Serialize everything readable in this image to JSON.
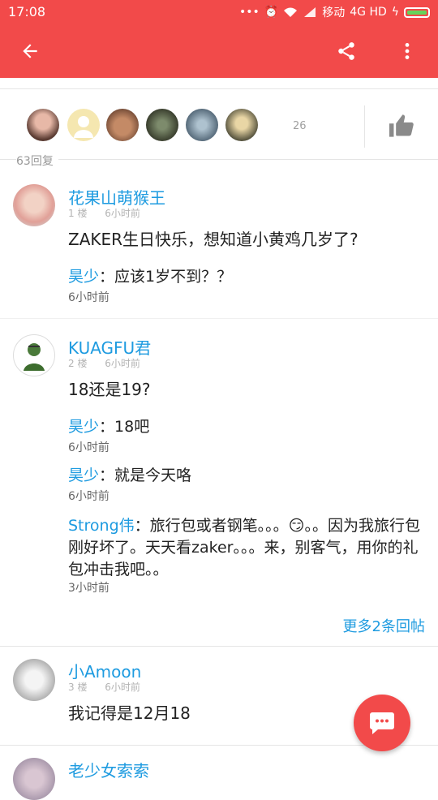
{
  "status": {
    "time": "17:08",
    "carrier": "移动",
    "network": "4G HD"
  },
  "likes": {
    "count": "26"
  },
  "replies_label": "63回复",
  "comments": [
    {
      "user": "花果山萌猴王",
      "floor": "1 楼",
      "time": "6小时前",
      "text": "ZAKER生日快乐，想知道小黄鸡几岁了?",
      "replies": [
        {
          "name": "昊少",
          "sep": "：",
          "text": "应该1岁不到？？",
          "time": "6小时前"
        }
      ]
    },
    {
      "user": "KUAGFU君",
      "floor": "2 楼",
      "time": "6小时前",
      "text": "18还是19?",
      "replies": [
        {
          "name": "昊少",
          "sep": "：",
          "text": "18吧",
          "time": "6小时前"
        },
        {
          "name": "昊少",
          "sep": "：",
          "text": "就是今天咯",
          "time": "6小时前"
        },
        {
          "name": "Strong伟",
          "sep": "：",
          "text_a": "旅行包或者钢笔。。。",
          "emoji": "😏",
          "text_b": "。。因为我旅行包刚好坏了。天天看zaker。。。来，别客气，用你的礼包冲击我吧。。",
          "time": "3小时前"
        }
      ],
      "more": "更多2条回帖"
    },
    {
      "user": "小Amoon",
      "floor": "3 楼",
      "time": "6小时前",
      "text": "我记得是12月18"
    },
    {
      "user": "老少女索索"
    }
  ],
  "icons": {
    "back": "arrow-left-icon",
    "share": "share-icon",
    "menu": "more-vertical-icon",
    "like": "thumb-up-icon",
    "fab": "chat-bubble-icon"
  },
  "colors": {
    "accent": "#f24a4a",
    "link": "#1e9be0"
  }
}
